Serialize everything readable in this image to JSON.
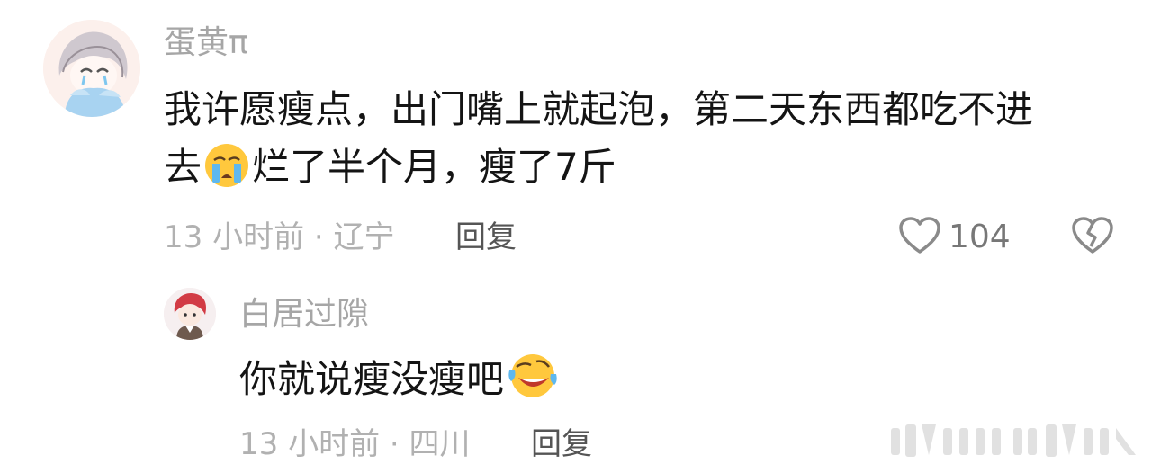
{
  "comment": {
    "username": "蛋黄π",
    "text_line1": "我许愿瘦点，出门嘴上就起泡，第二天东西都吃不进",
    "text_line2_before": "去",
    "text_line2_emoji": "crying-face-emoji",
    "text_line2_after": "烂了半个月，瘦了7斤",
    "time_location": "13 小时前 · 辽宁",
    "reply_label": "回复",
    "like_count": "104",
    "like_icon": "heart-outline-icon",
    "dislike_icon": "broken-heart-icon"
  },
  "reply": {
    "username": "白居过隙",
    "text_before": "你就说瘦没瘦吧",
    "text_emoji": "rolling-laughing-emoji",
    "time_location": "13 小时前 · 四川",
    "reply_label": "回复"
  },
  "colors": {
    "username": "#a6a6a6",
    "text": "#141414",
    "meta": "#b1b1b1",
    "reply": "#555555",
    "icon": "#8a8a8a"
  }
}
